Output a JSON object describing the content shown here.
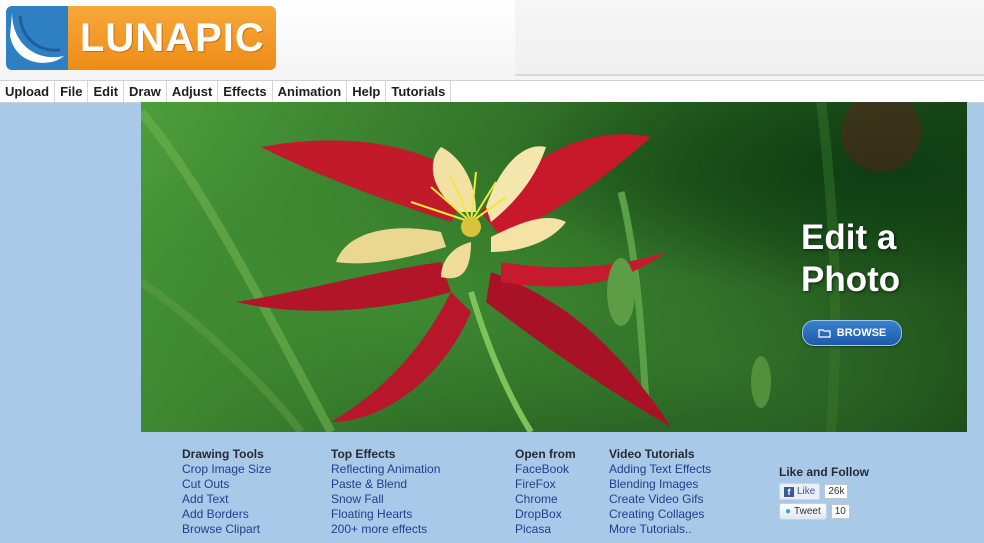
{
  "brand": {
    "name": "LUNAPIC"
  },
  "menu": [
    "Upload",
    "File",
    "Edit",
    "Draw",
    "Adjust",
    "Effects",
    "Animation",
    "Help",
    "Tutorials"
  ],
  "hero": {
    "line1": "Edit a",
    "line2": "Photo",
    "browse_label": "BROWSE"
  },
  "columns": [
    {
      "head": "Drawing Tools",
      "links": [
        "Crop Image Size",
        "Cut Outs",
        "Add Text",
        "Add Borders",
        "Browse Clipart"
      ]
    },
    {
      "head": "Top Effects",
      "links": [
        "Reflecting Animation",
        "Paste & Blend",
        "Snow Fall",
        "Floating Hearts",
        "200+ more effects"
      ]
    },
    {
      "head": "Open from",
      "links": [
        "FaceBook",
        "FireFox",
        "Chrome",
        "DropBox",
        "Picasa"
      ]
    },
    {
      "head": "Video Tutorials",
      "links": [
        "Adding Text Effects",
        "Blending Images",
        "Create Video Gifs",
        "Creating Collages",
        "More Tutorials.."
      ]
    }
  ],
  "social": {
    "head": "Like and Follow",
    "like_label": "Like",
    "like_count": "26k",
    "tweet_label": "Tweet",
    "tweet_count": "10"
  },
  "colors": {
    "page_bg": "#a9c9e9",
    "logo_blue": "#2f7fc3",
    "logo_orange": "#ee8c17",
    "link": "#1f3f8f",
    "browse_btn": "#1d5ba8"
  },
  "icons": {
    "browse": "folder-icon",
    "facebook": "facebook-icon",
    "twitter": "twitter-bird-icon"
  }
}
